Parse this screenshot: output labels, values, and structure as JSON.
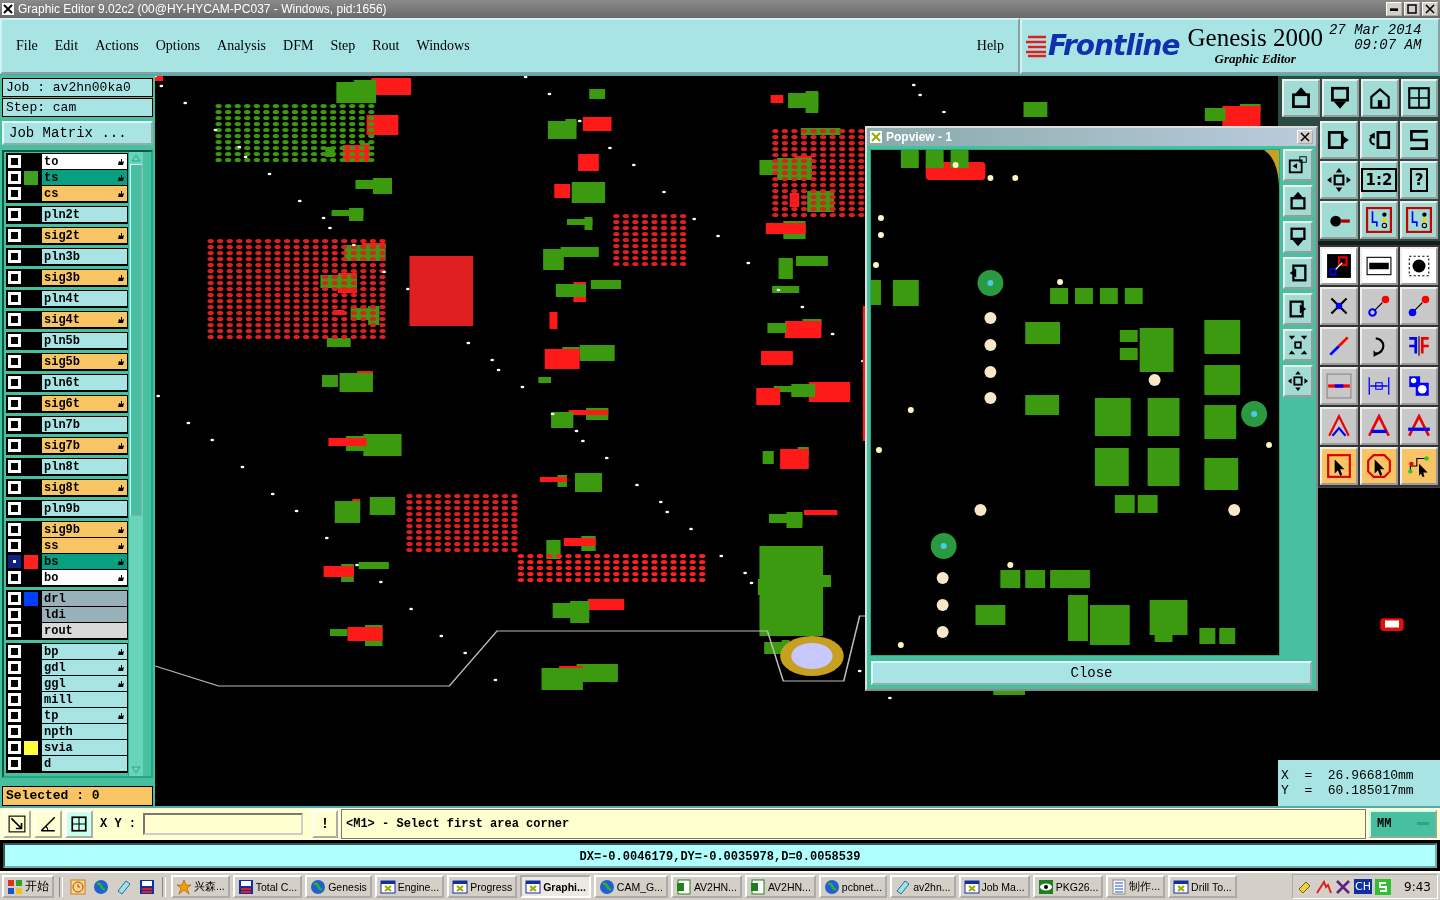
{
  "window": {
    "title": "Graphic Editor 9.02c2 (00@HY-HYCAM-PC037 - Windows, pid:1656)"
  },
  "menu": [
    "File",
    "Edit",
    "Actions",
    "Options",
    "Analysis",
    "DFM",
    "Step",
    "Rout",
    "Windows"
  ],
  "help_menu": "Help",
  "brand": {
    "logo": "Frontline",
    "product": "Genesis 2000",
    "subtitle": "Graphic Editor",
    "date": "27 Mar 2014",
    "time": "09:07 AM"
  },
  "job": {
    "job": "Job  :  av2hn00ka0",
    "step": "Step:  cam",
    "matrix_button": "Job Matrix ..."
  },
  "layer_groups": [
    [
      {
        "name": "to",
        "kind": "document",
        "affected": true,
        "selected": false
      },
      {
        "name": "ts",
        "kind": "mask",
        "color": "#40a020",
        "affected": true,
        "selected": false
      },
      {
        "name": "cs",
        "kind": "signal",
        "affected": true,
        "selected": false
      }
    ],
    [
      {
        "name": "pln2t",
        "kind": "plane",
        "affected": false,
        "selected": false
      }
    ],
    [
      {
        "name": "sig2t",
        "kind": "signal",
        "affected": true,
        "selected": false
      }
    ],
    [
      {
        "name": "pln3b",
        "kind": "plane",
        "affected": false,
        "selected": false
      }
    ],
    [
      {
        "name": "sig3b",
        "kind": "signal",
        "affected": true,
        "selected": false
      }
    ],
    [
      {
        "name": "pln4t",
        "kind": "plane",
        "affected": false,
        "selected": false
      }
    ],
    [
      {
        "name": "sig4t",
        "kind": "signal",
        "affected": true,
        "selected": false
      }
    ],
    [
      {
        "name": "pln5b",
        "kind": "plane",
        "affected": false,
        "selected": false
      }
    ],
    [
      {
        "name": "sig5b",
        "kind": "signal",
        "affected": true,
        "selected": false
      }
    ],
    [
      {
        "name": "pln6t",
        "kind": "plane",
        "affected": false,
        "selected": false
      }
    ],
    [
      {
        "name": "sig6t",
        "kind": "signal",
        "affected": true,
        "selected": false
      }
    ],
    [
      {
        "name": "pln7b",
        "kind": "plane",
        "affected": false,
        "selected": false
      }
    ],
    [
      {
        "name": "sig7b",
        "kind": "signal",
        "affected": true,
        "selected": false
      }
    ],
    [
      {
        "name": "pln8t",
        "kind": "plane",
        "affected": false,
        "selected": false
      }
    ],
    [
      {
        "name": "sig8t",
        "kind": "signal",
        "affected": true,
        "selected": false
      }
    ],
    [
      {
        "name": "pln9b",
        "kind": "plane",
        "affected": false,
        "selected": false
      }
    ],
    [
      {
        "name": "sig9b",
        "kind": "signal",
        "affected": true,
        "selected": false
      },
      {
        "name": "ss",
        "kind": "signal",
        "affected": true,
        "selected": false
      },
      {
        "name": "bs",
        "kind": "mask",
        "color": "#ff2020",
        "affected": true,
        "selected": true
      },
      {
        "name": "bo",
        "kind": "document",
        "affected": true,
        "selected": false
      }
    ],
    [
      {
        "name": "drl",
        "kind": "drill",
        "color": "#0040ff",
        "affected": false,
        "selected": false
      },
      {
        "name": "ldi",
        "kind": "drill",
        "affected": false,
        "selected": false
      },
      {
        "name": "rout",
        "kind": "rout",
        "affected": false,
        "selected": false
      }
    ],
    [
      {
        "name": "bp",
        "kind": "plane",
        "affected": true,
        "selected": false
      },
      {
        "name": "gdl",
        "kind": "plane",
        "affected": true,
        "selected": false
      },
      {
        "name": "ggl",
        "kind": "plane",
        "affected": true,
        "selected": false
      },
      {
        "name": "mill",
        "kind": "plane",
        "affected": false,
        "selected": false
      },
      {
        "name": "tp",
        "kind": "plane",
        "affected": true,
        "selected": false
      },
      {
        "name": "npth",
        "kind": "plane",
        "affected": false,
        "selected": false
      },
      {
        "name": "svia",
        "kind": "plane",
        "color": "#ffff40",
        "affected": false,
        "selected": false
      },
      {
        "name": "d",
        "kind": "plane",
        "affected": false,
        "selected": false
      }
    ]
  ],
  "selected_count": "Selected : 0",
  "popview": {
    "title": "Popview - 1",
    "close_button": "Close",
    "side_tools": [
      {
        "kind": "window-arrow"
      },
      {
        "kind": "export"
      },
      {
        "kind": "import"
      },
      {
        "kind": "left-in"
      },
      {
        "kind": "right-in"
      },
      {
        "kind": "shrink"
      },
      {
        "kind": "move"
      }
    ]
  },
  "toolbar_top": [
    {
      "kind": "export"
    },
    {
      "kind": "import"
    },
    {
      "kind": "home"
    },
    {
      "kind": "grid"
    }
  ],
  "toolbar": [
    {
      "kind": "arrow-box"
    },
    {
      "kind": "undo-box"
    },
    {
      "kind": "s-curve"
    },
    {
      "kind": "move"
    },
    {
      "kind": "text",
      "label": "1:2"
    },
    {
      "kind": "text",
      "label": "?"
    },
    {
      "kind": "pad-trace"
    },
    {
      "kind": "circuit"
    },
    {
      "kind": "circuit"
    }
  ],
  "toolbar_edit": [
    {
      "kind": "snap"
    },
    {
      "kind": "ruler"
    },
    {
      "kind": "pad"
    },
    {
      "kind": "cross"
    },
    {
      "kind": "link"
    },
    {
      "kind": "link-filled"
    },
    {
      "kind": "line-diag"
    },
    {
      "kind": "rotate"
    },
    {
      "kind": "mirror"
    },
    {
      "kind": "line-h"
    },
    {
      "kind": "dimension"
    },
    {
      "kind": "shapes"
    },
    {
      "kind": "triangle"
    },
    {
      "kind": "triangle-bar"
    },
    {
      "kind": "triangle-cross"
    },
    {
      "kind": "pointer"
    },
    {
      "kind": "pointer-oct"
    },
    {
      "kind": "route-pointer"
    }
  ],
  "coordinates": [
    "X  =  26.966810mm",
    "Y  =  60.185017mm"
  ],
  "command": {
    "xy_label": "X Y :",
    "alert_button": "!",
    "message": "<M1> - Select first area corner",
    "units": "MM"
  },
  "status_bar": "DX=-0.0046179,DY=-0.0035978,D=0.0058539",
  "taskbar": {
    "start": "开始",
    "tasks": [
      {
        "label": "兴森...",
        "selected": false
      },
      {
        "label": "Total C...",
        "selected": false
      },
      {
        "label": "Genesis",
        "selected": false
      },
      {
        "label": "Engine...",
        "selected": false
      },
      {
        "label": "Progress",
        "selected": false
      },
      {
        "label": "Graphi...",
        "selected": true
      },
      {
        "label": "CAM_G...",
        "selected": false
      },
      {
        "label": "AV2HN...",
        "selected": false
      },
      {
        "label": "AV2HN...",
        "selected": false
      },
      {
        "label": "pcbnet...",
        "selected": false
      },
      {
        "label": "av2hn...",
        "selected": false
      },
      {
        "label": "Job Ma...",
        "selected": false
      },
      {
        "label": "PKG26...",
        "selected": false
      },
      {
        "label": "制作...",
        "selected": false
      },
      {
        "label": "Drill To...",
        "selected": false
      }
    ],
    "language": "CH",
    "clock": "9:43"
  }
}
